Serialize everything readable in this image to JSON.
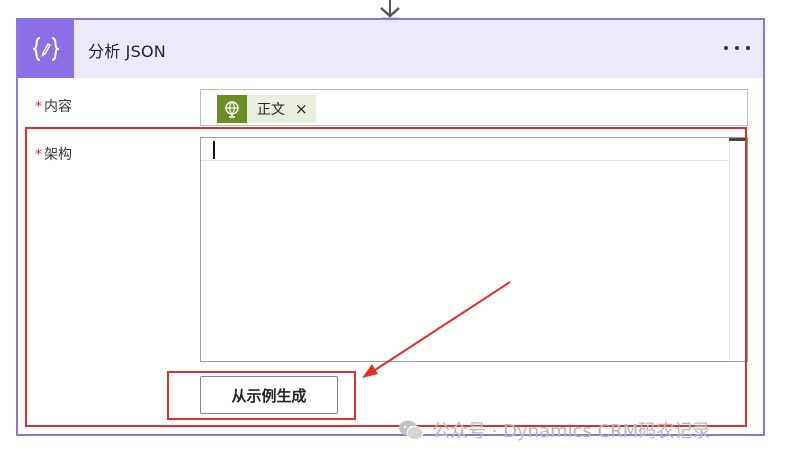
{
  "action_card": {
    "title": "分析 JSON",
    "header_icon": "curly-braces-edit-icon",
    "accent_color": "#8c6fe6",
    "header_bg": "#ece9fb"
  },
  "fields": {
    "content": {
      "required_mark": "*",
      "label": "内容",
      "token": {
        "label": "正文",
        "icon": "globe-icon",
        "icon_bg": "#6b8e23",
        "remove_glyph": "×"
      }
    },
    "schema": {
      "required_mark": "*",
      "label": "架构",
      "value": ""
    }
  },
  "buttons": {
    "generate_from_sample": "从示例生成"
  },
  "annotation": {
    "color": "#e0302a"
  },
  "watermark": {
    "text": "公众号 · Dynamics CRM码农记录",
    "icon": "wechat-icon"
  }
}
